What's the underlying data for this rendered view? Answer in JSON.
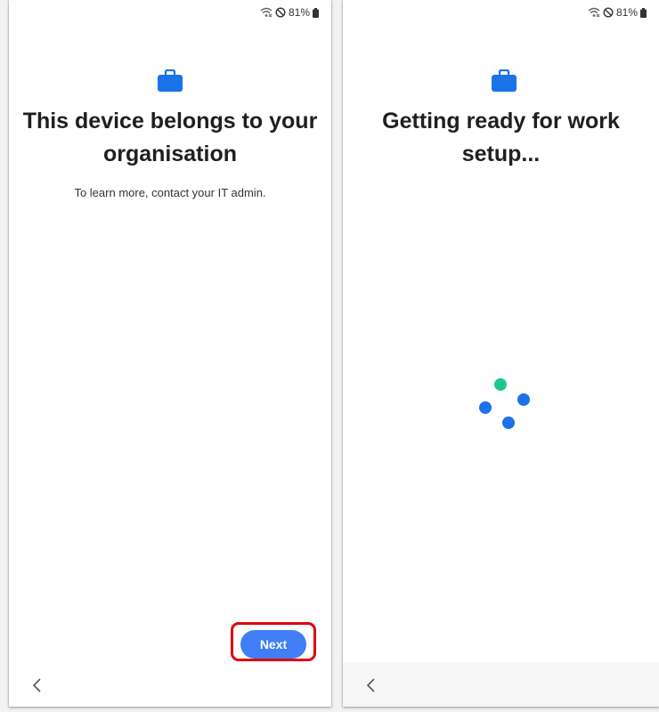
{
  "colors": {
    "accent": "#3f7ef5",
    "briefcase": "#1a73e8",
    "highlight": "#e0000b",
    "spinner_blue": "#1a73e8",
    "spinner_green": "#1ec68f"
  },
  "status_bar": {
    "battery": "81%",
    "icons": [
      "wifi-off-icon",
      "do-not-disturb-icon",
      "battery-icon"
    ]
  },
  "screen_left": {
    "icon": "briefcase-icon",
    "title": "This device belongs to your organisation",
    "subtitle": "To learn more, contact your IT admin.",
    "next_label": "Next",
    "back_icon": "chevron-left-icon"
  },
  "screen_right": {
    "icon": "briefcase-icon",
    "title": "Getting ready for work setup...",
    "spinner_icon": "loading-spinner-icon",
    "back_icon": "chevron-left-icon"
  }
}
